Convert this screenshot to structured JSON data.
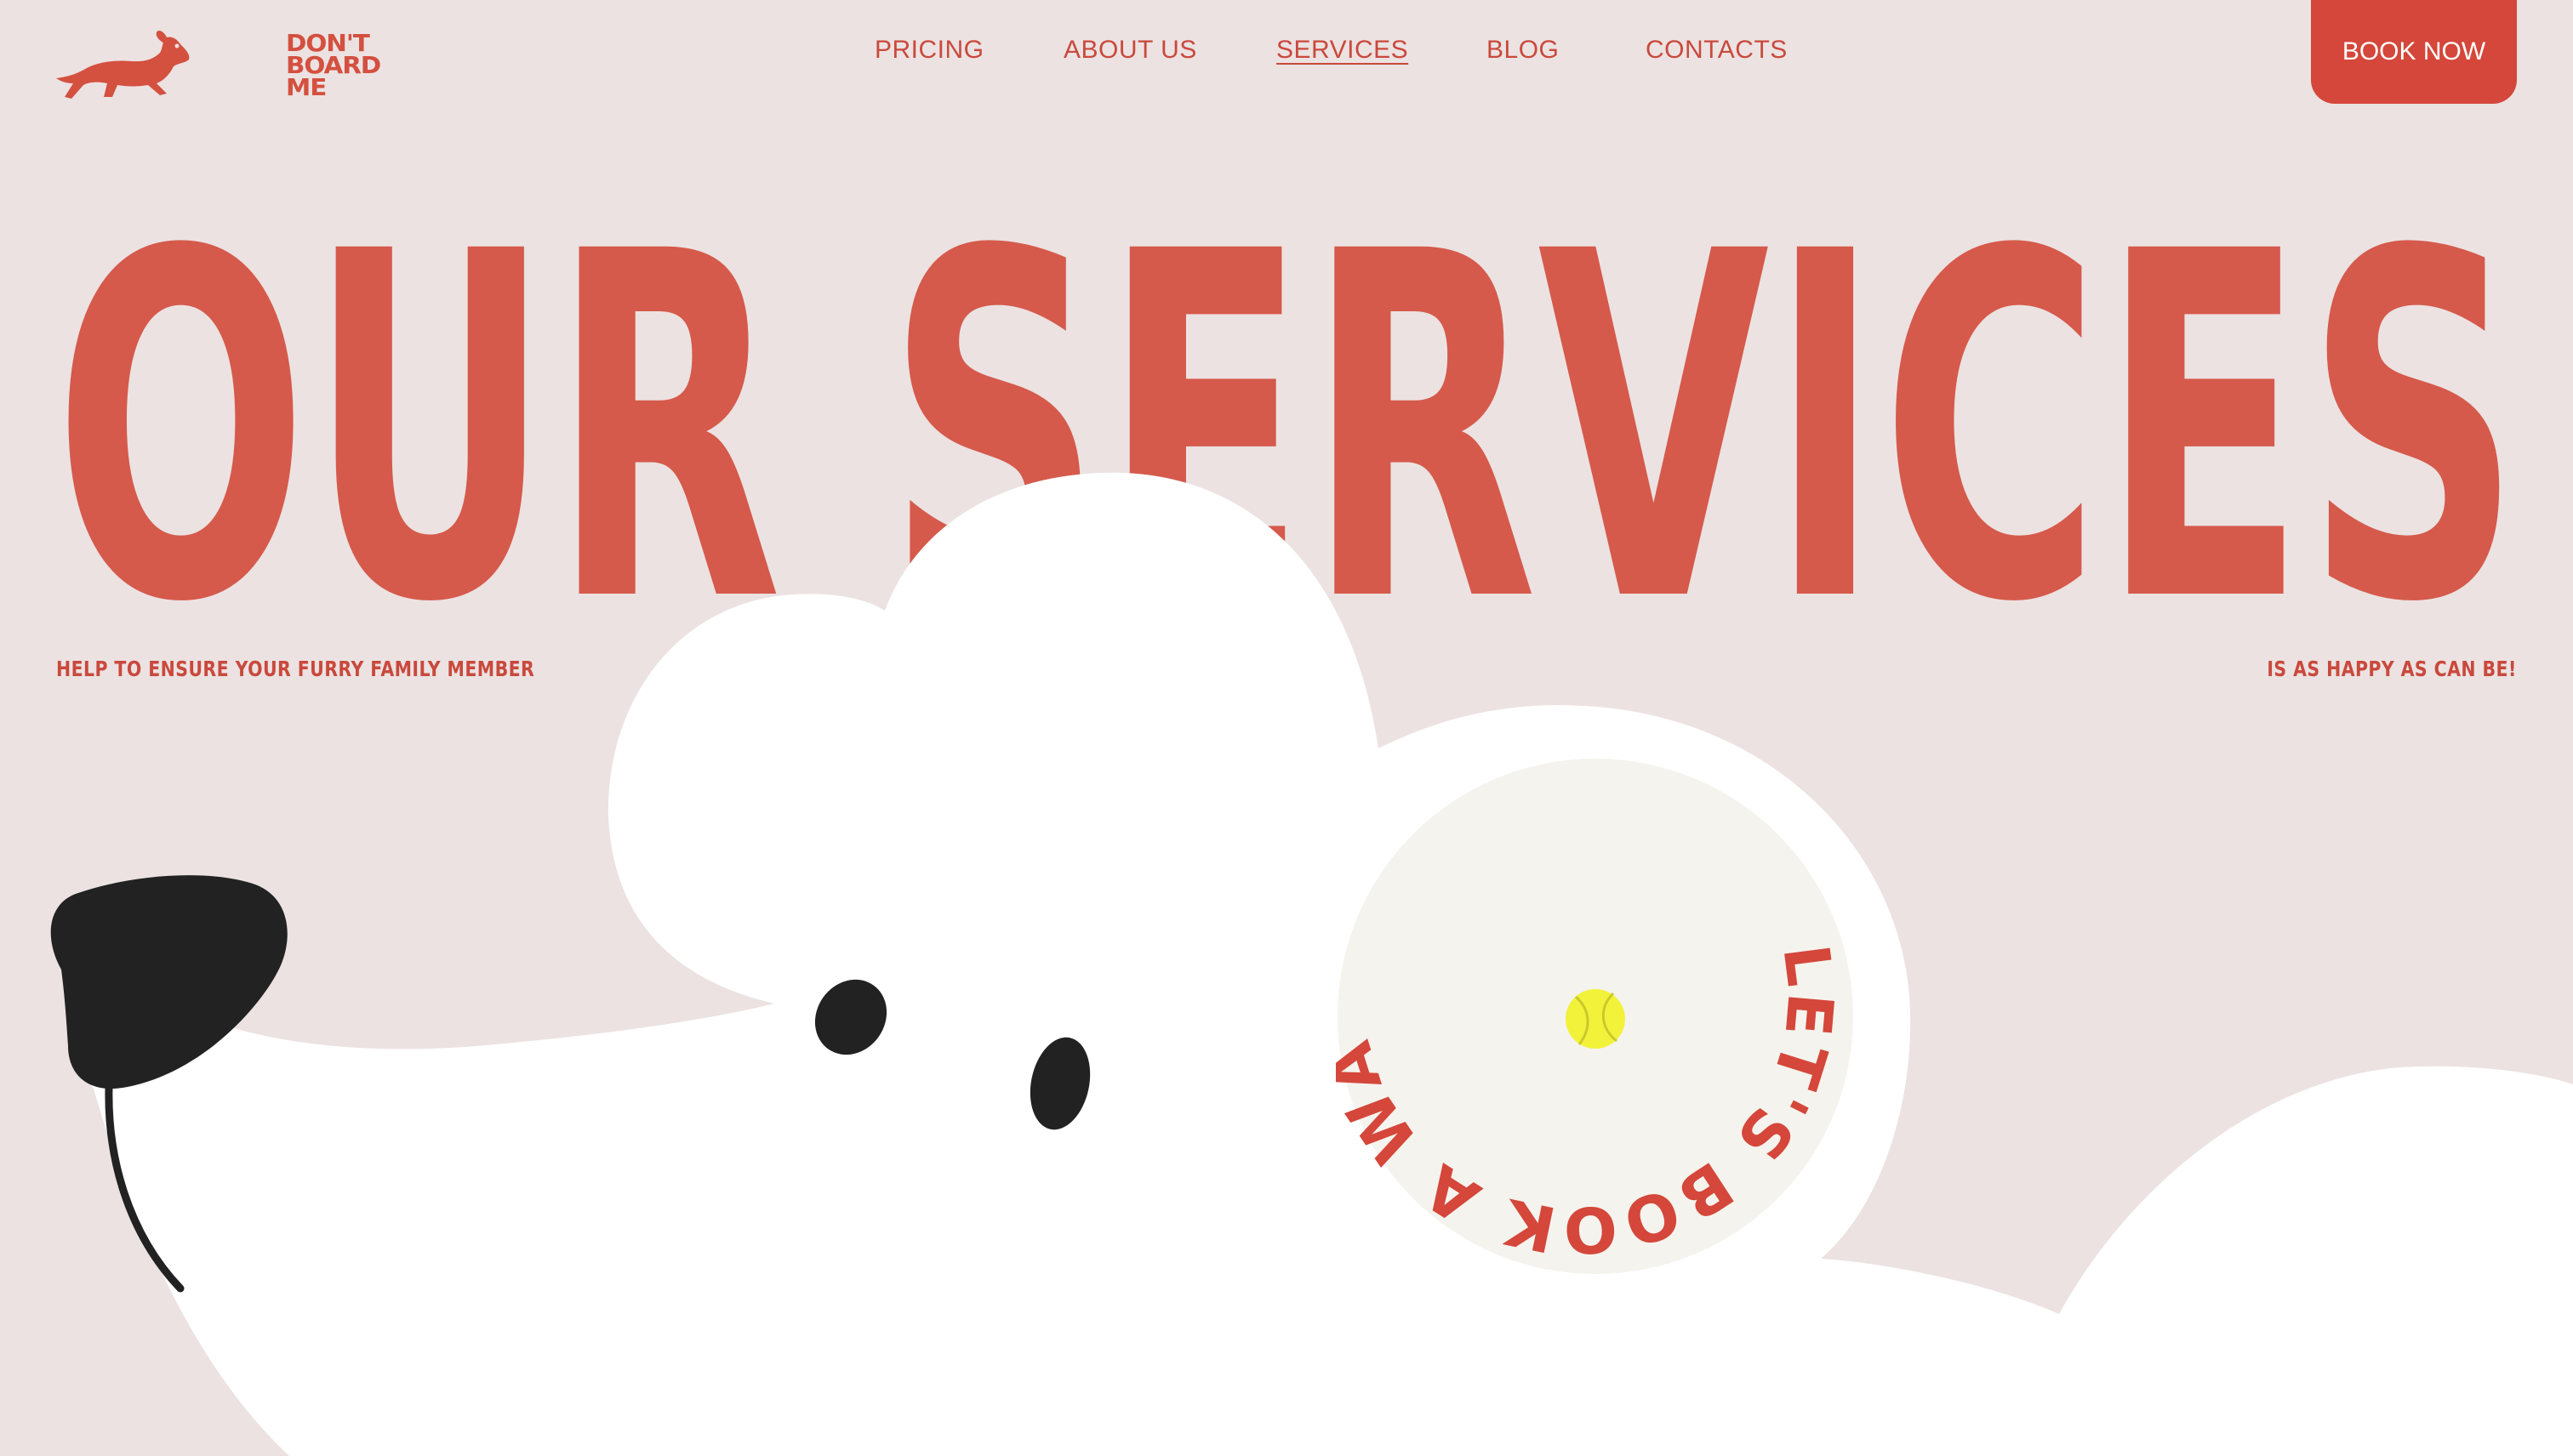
{
  "brand": {
    "logo_lines": [
      "DON'T",
      "BOARD",
      "ME"
    ],
    "logo_icon": "dachshund-icon"
  },
  "nav": {
    "items": [
      {
        "label": "PRICING",
        "active": false
      },
      {
        "label": "ABOUT US",
        "active": false
      },
      {
        "label": "SERVICES",
        "active": true
      },
      {
        "label": "BLOG",
        "active": false
      },
      {
        "label": "CONTACTS",
        "active": false
      }
    ],
    "cta": "BOOK NOW"
  },
  "hero": {
    "title": "OUR SERVICES",
    "tagline_left": "HELP TO ENSURE YOUR FURRY FAMILY MEMBER",
    "tagline_right": "IS AS HAPPY AS CAN BE!"
  },
  "badge": {
    "text": "LET'S BOOK A WALK",
    "icon": "tennis-ball-icon"
  },
  "colors": {
    "background": "#ece2e2",
    "accent": "#d4503f",
    "button": "#d4473a",
    "dog": "#ffffff",
    "nose": "#222222",
    "badge_bg": "#f5f3ee",
    "ball": "#f2f23a"
  }
}
